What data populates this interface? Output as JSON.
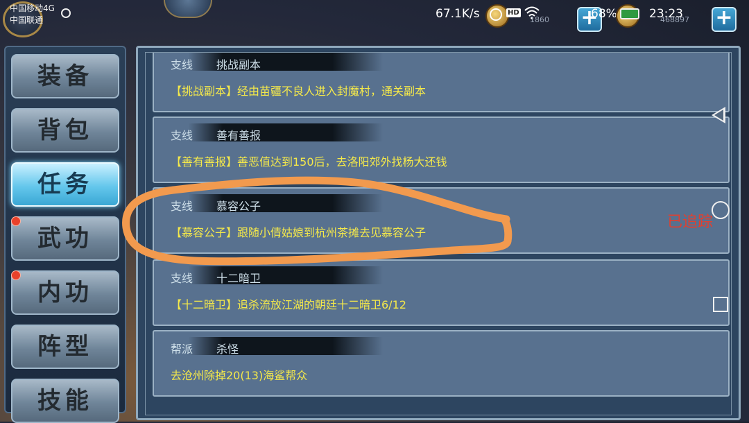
{
  "statusbar": {
    "carrier_1": "中国移动4G",
    "carrier_2": "中国联通",
    "net_speed": "67.1K/s",
    "hd_badge": "HD",
    "battery": "68%",
    "time": "23:23"
  },
  "currency": {
    "silver": "1860",
    "gold": "468897",
    "add_symbol": "+"
  },
  "sidebar": {
    "items": [
      {
        "label": "装备",
        "active": false,
        "dot": false
      },
      {
        "label": "背包",
        "active": false,
        "dot": false
      },
      {
        "label": "任务",
        "active": true,
        "dot": false
      },
      {
        "label": "武功",
        "active": false,
        "dot": true
      },
      {
        "label": "内功",
        "active": false,
        "dot": true
      },
      {
        "label": "阵型",
        "active": false,
        "dot": false
      },
      {
        "label": "技能",
        "active": false,
        "dot": false
      }
    ]
  },
  "quests": [
    {
      "type": "支线",
      "name": "挑战副本",
      "desc": "【挑战副本】经由苗疆不良人进入封魔村，通关副本"
    },
    {
      "type": "支线",
      "name": "善有善报",
      "desc": "【善有善报】善恶值达到150后，去洛阳郊外找杨大还钱"
    },
    {
      "type": "支线",
      "name": "慕容公子",
      "desc": "【慕容公子】跟随小倩姑娘到杭州茶摊去见慕容公子"
    },
    {
      "type": "支线",
      "name": "十二暗卫",
      "desc": "【十二暗卫】追杀流放江湖的朝廷十二暗卫6/12"
    },
    {
      "type": "帮派",
      "name": "杀怪",
      "desc": "去沧州除掉20(13)海鲨帮众"
    }
  ],
  "tracked_label": "已追踪",
  "colors": {
    "accent_active": "#64c7ec",
    "quest_text": "#f5e94a",
    "tracked": "#e04030",
    "scribble": "#f29a4e"
  }
}
